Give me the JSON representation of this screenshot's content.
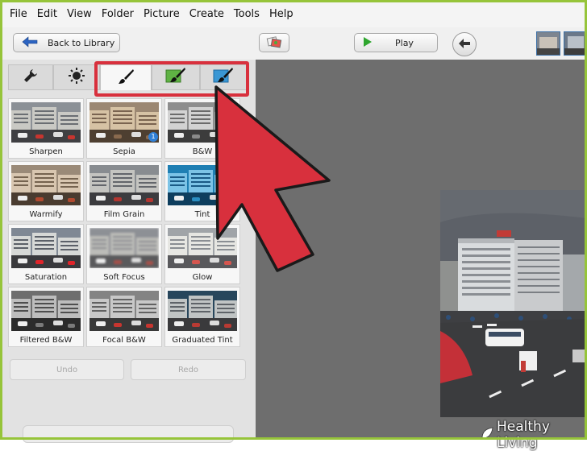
{
  "menu": [
    "File",
    "Edit",
    "View",
    "Folder",
    "Picture",
    "Create",
    "Tools",
    "Help"
  ],
  "toolbar": {
    "back_label": "Back to Library",
    "play_label": "Play"
  },
  "tabs": [
    {
      "icon": "wrench-icon"
    },
    {
      "icon": "sun-icon"
    },
    {
      "icon": "brush-icon"
    },
    {
      "icon": "brush-green-icon"
    },
    {
      "icon": "brush-blue-icon"
    }
  ],
  "effects": [
    {
      "label": "Sharpen",
      "tone": "normal"
    },
    {
      "label": "Sepia",
      "tone": "sepia",
      "badge": "1"
    },
    {
      "label": "B&W",
      "tone": "bw"
    },
    {
      "label": "Warmify",
      "tone": "warm"
    },
    {
      "label": "Film Grain",
      "tone": "grain"
    },
    {
      "label": "Tint",
      "tone": "tint"
    },
    {
      "label": "Saturation",
      "tone": "sat"
    },
    {
      "label": "Soft Focus",
      "tone": "soft"
    },
    {
      "label": "Glow",
      "tone": "glow"
    },
    {
      "label": "Filtered B&W",
      "tone": "fbw"
    },
    {
      "label": "Focal B&W",
      "tone": "focal"
    },
    {
      "label": "Graduated Tint",
      "tone": "grad"
    }
  ],
  "actions": {
    "undo": "Undo",
    "redo": "Redo"
  },
  "watermark": {
    "text": "Healthy Living"
  },
  "colors": {
    "highlight": "#d8303d",
    "canvas": "#6e6e6e",
    "accent": "#2f7fd6"
  }
}
